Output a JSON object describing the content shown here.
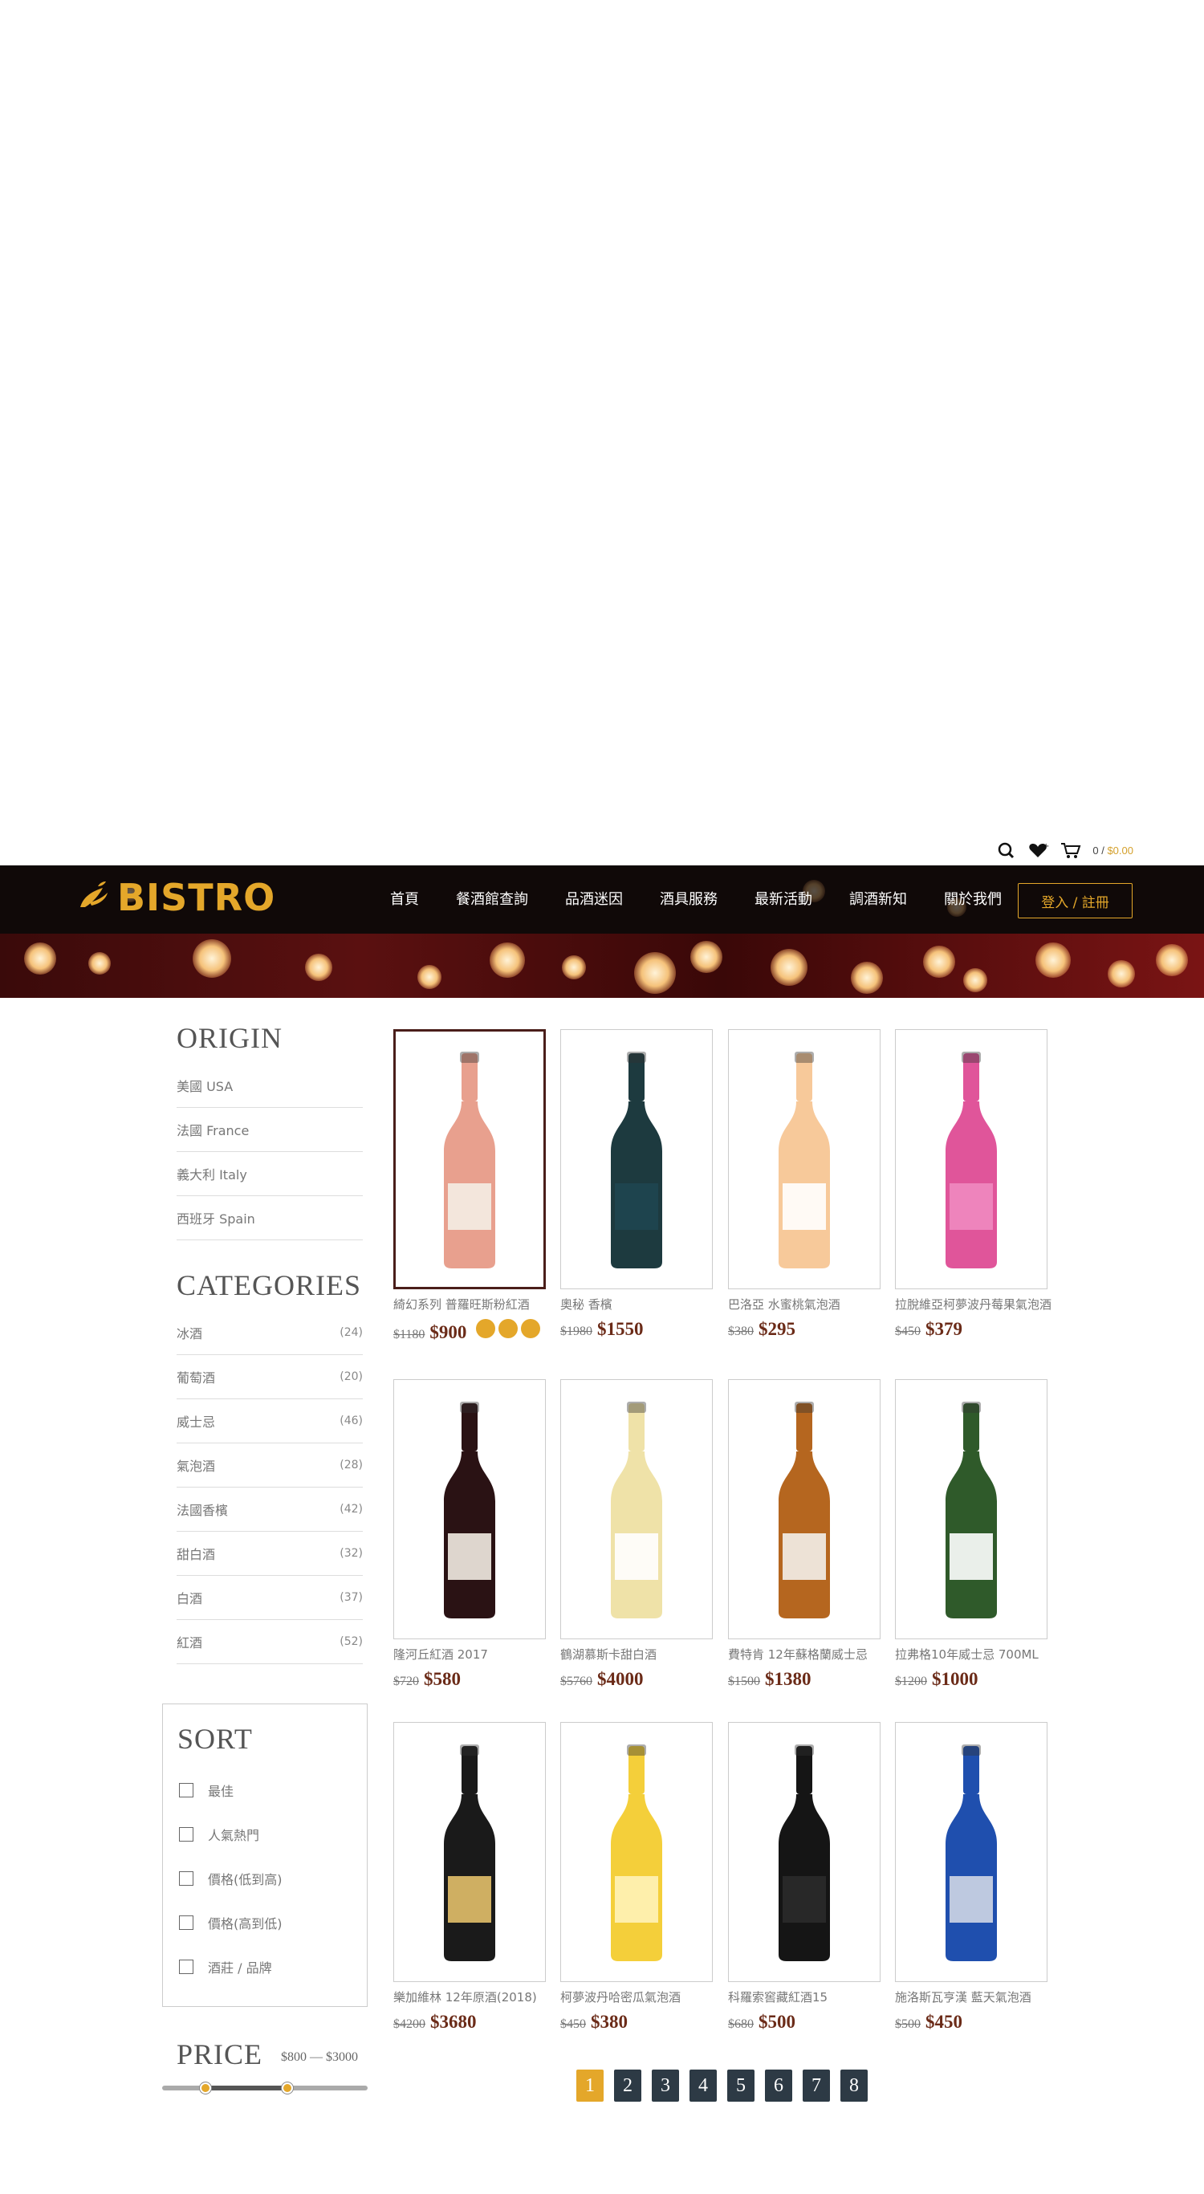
{
  "util": {
    "cart_count": "0 / ",
    "cart_amount": "$0.00"
  },
  "logo": {
    "text": "BISTRO"
  },
  "nav": [
    "首頁",
    "餐酒館查詢",
    "品酒迷因",
    "酒具服務",
    "最新活動",
    "調酒新知",
    "關於我們"
  ],
  "login_label": "登入 / 註冊",
  "origin": {
    "heading": "ORIGIN",
    "items": [
      "美國  USA",
      "法國  France",
      "義大利  Italy",
      "西班牙  Spain"
    ]
  },
  "categories": {
    "heading": "CATEGORIES",
    "items": [
      {
        "label": "冰酒",
        "count": "(24)"
      },
      {
        "label": "葡萄酒",
        "count": "(20)"
      },
      {
        "label": "威士忌",
        "count": "(46)"
      },
      {
        "label": "氣泡酒",
        "count": "(28)"
      },
      {
        "label": "法國香檳",
        "count": "(42)"
      },
      {
        "label": "甜白酒",
        "count": "(32)"
      },
      {
        "label": "白酒",
        "count": "(37)"
      },
      {
        "label": "紅酒",
        "count": "(52)"
      }
    ]
  },
  "sort": {
    "heading": "SORT",
    "options": [
      "最佳",
      "人氣熱門",
      "價格(低到高)",
      "價格(高到低)",
      "酒莊 / 品牌"
    ]
  },
  "price": {
    "heading": "PRICE",
    "range": "$800 — $3000",
    "min_fraction": 0.21,
    "max_fraction": 0.61
  },
  "products": [
    {
      "name": "綺幻系列 普羅旺斯粉紅酒",
      "old": "$1180",
      "new": "$900",
      "bottle": "#e8a08e",
      "label": "#f4ede4"
    },
    {
      "name": "奧秘 香檳",
      "old": "$1980",
      "new": "$1550",
      "bottle": "#1d3a3f",
      "label": "#1f4650"
    },
    {
      "name": "巴洛亞 水蜜桃氣泡酒",
      "old": "$380",
      "new": "$295",
      "bottle": "#f7c99a",
      "label": "#ffffff"
    },
    {
      "name": "拉脫維亞柯夢波丹莓果氣泡酒",
      "old": "$450",
      "new": "$379",
      "bottle": "#e0559a",
      "label": "#f08ac0"
    },
    {
      "name": "隆河丘紅酒 2017",
      "old": "$720",
      "new": "$580",
      "bottle": "#2a1214",
      "label": "#f2ece2"
    },
    {
      "name": "鶴湖慕斯卡甜白酒",
      "old": "$5760",
      "new": "$4000",
      "bottle": "#efe2a8",
      "label": "#ffffff"
    },
    {
      "name": "費特肯 12年蘇格蘭威士忌",
      "old": "$1500",
      "new": "$1380",
      "bottle": "#b5661f",
      "label": "#f3f0ea"
    },
    {
      "name": "拉弗格10年威士忌 700ML",
      "old": "$1200",
      "new": "$1000",
      "bottle": "#2f5a2a",
      "label": "#ffffff"
    },
    {
      "name": "樂加維林 12年原酒(2018)",
      "old": "$4200",
      "new": "$3680",
      "bottle": "#1a1a1a",
      "label": "#e3c06a"
    },
    {
      "name": "柯夢波丹哈密瓜氣泡酒",
      "old": "$450",
      "new": "$380",
      "bottle": "#f4cf3a",
      "label": "#fff2b8"
    },
    {
      "name": "科羅索窖藏紅酒15",
      "old": "$680",
      "new": "$500",
      "bottle": "#151515",
      "label": "#2a2a2a"
    },
    {
      "name": "施洛斯瓦亨漢 藍天氣泡酒",
      "old": "$500",
      "new": "$450",
      "bottle": "#1f4fae",
      "label": "#cfd6e6"
    }
  ],
  "pagination": [
    "1",
    "2",
    "3",
    "4",
    "5",
    "6",
    "7",
    "8"
  ],
  "pagination_current": "1"
}
